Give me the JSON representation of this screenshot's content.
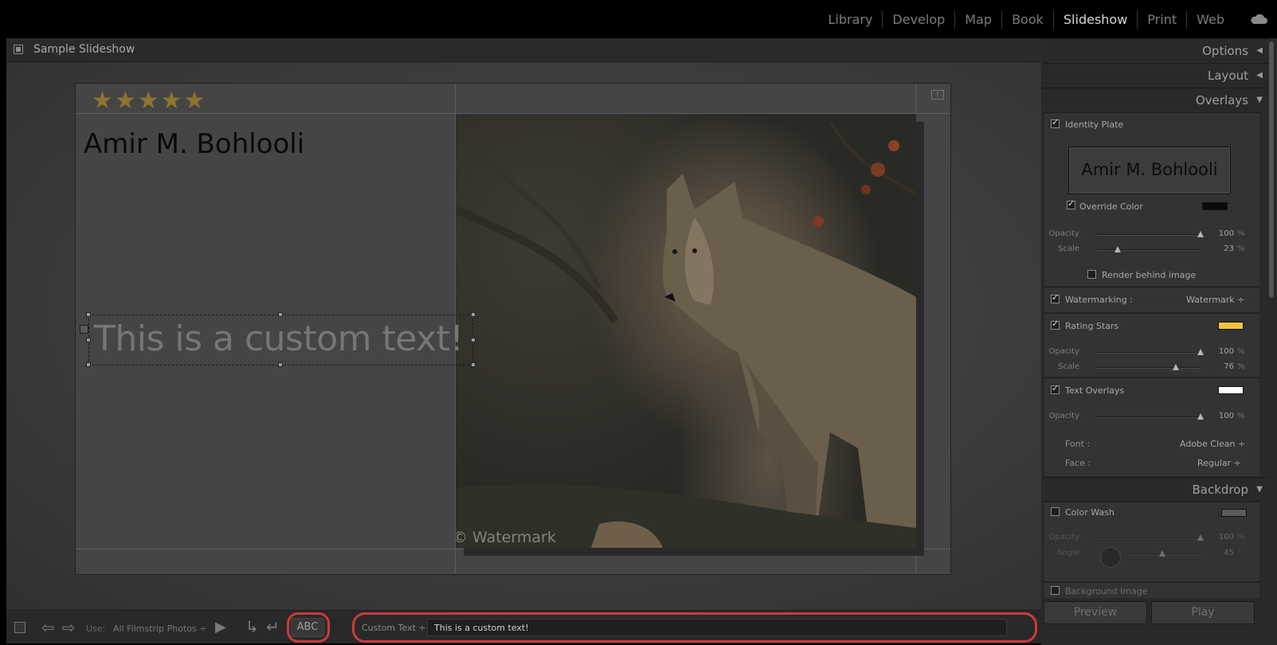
{
  "modules": [
    "Library",
    "Develop",
    "Map",
    "Book",
    "Slideshow",
    "Print",
    "Web"
  ],
  "active_module": "Slideshow",
  "slideshow_name": "Sample Slideshow",
  "slide": {
    "stars": [
      "★",
      "★",
      "★",
      "★",
      "★"
    ],
    "identity_plate": "Amir M. Bohlooli",
    "custom_text": "This is a custom text!",
    "watermark": "© Watermark",
    "page_indicator": "!"
  },
  "toolbar": {
    "use_label": "Use:",
    "use_value": "All Filmstrip Photos ÷",
    "abc_label": "ABC",
    "text_source": "Custom Text ÷",
    "text_value": "This is a custom text!"
  },
  "panel": {
    "options_title": "Options",
    "layout_title": "Layout",
    "overlays_title": "Overlays",
    "backdrop_title": "Backdrop",
    "identity_plate_label": "Identity Plate",
    "identity_plate_preview": "Amir M. Bohlooli",
    "override_color_label": "Override Color",
    "override_color": "#0a0a0a",
    "opacity_label": "Opacity",
    "scale_label": "Scale",
    "percent": "%",
    "plate_opacity": "100",
    "plate_scale": "23",
    "render_behind_label": "Render behind image",
    "watermarking_label": "Watermarking :",
    "watermarking_value": "Watermark ÷",
    "rating_stars_label": "Rating Stars",
    "rating_color": "#f3c33e",
    "stars_opacity": "100",
    "stars_scale": "76",
    "text_overlays_label": "Text Overlays",
    "text_color": "#ffffff",
    "text_opacity": "100",
    "font_label": "Font :",
    "font_value": "Adobe Clean ÷",
    "face_label": "Face :",
    "face_value": "Regular ÷",
    "color_wash_label": "Color Wash",
    "wash_opacity": "100",
    "angle_label": "Angle",
    "angle_value": "45",
    "angle_unit": "°",
    "background_image_label": "Background Image",
    "preview_label": "Preview",
    "play_label": "Play"
  },
  "sliders": {
    "plate_opacity": 1.0,
    "plate_scale": 0.2,
    "stars_opacity": 1.0,
    "stars_scale": 0.76,
    "text_opacity": 1.0,
    "wash_opacity": 1.0,
    "angle": 0.5
  },
  "colors": {
    "accent_highlight": "#cc3a3a",
    "star_color": "#8c7431"
  }
}
